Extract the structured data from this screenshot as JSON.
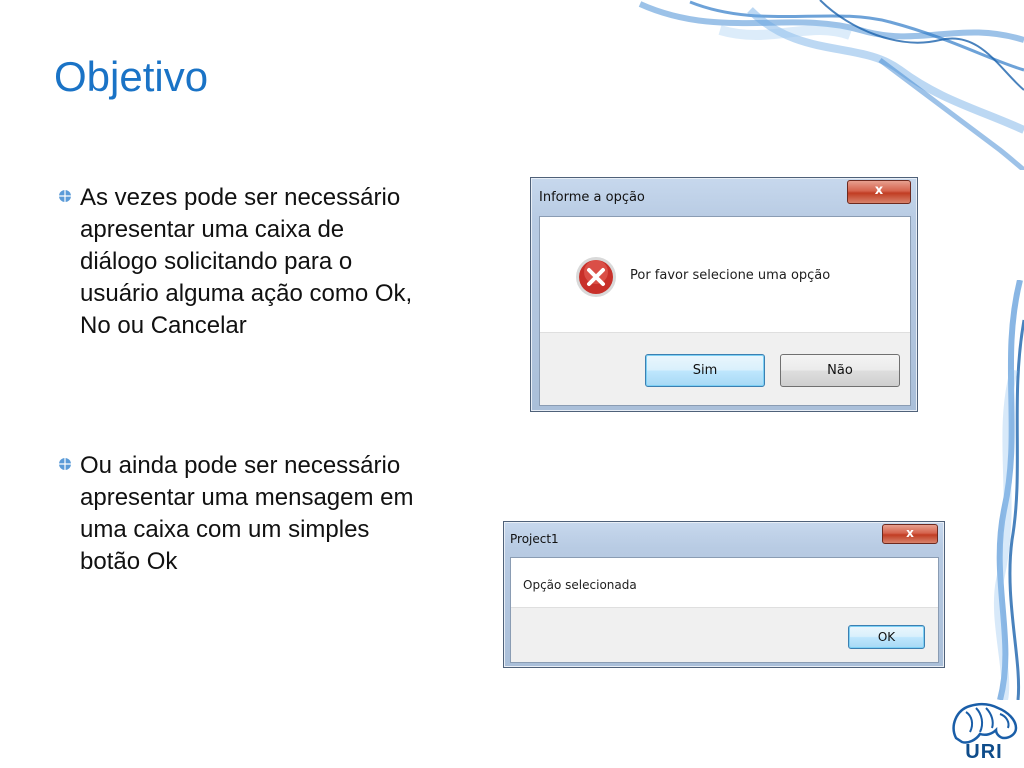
{
  "slide": {
    "title": "Objetivo",
    "title_color": "#1a73c6",
    "accent_color": "#4a8fd6"
  },
  "bullets": [
    {
      "text": "As vezes pode ser necessário\napresentar uma caixa de\ndiálogo solicitando para o\nusuário alguma ação como Ok,\nNo ou Cancelar"
    },
    {
      "text": "Ou ainda pode ser necessário\napresentar uma mensagem em\numa caixa com um simples\nbotão Ok"
    }
  ],
  "dialog1": {
    "title": "Informe a opção",
    "close_label": "x",
    "message": "Por favor selecione uma opção",
    "icon": "error-icon",
    "buttons": {
      "yes": "Sim",
      "no": "Não"
    }
  },
  "dialog2": {
    "title": "Project1",
    "close_label": "x",
    "message": "Opção selecionada",
    "buttons": {
      "ok": "OK"
    }
  },
  "logo": {
    "text": "URI",
    "icon": "uri-logo-icon"
  }
}
